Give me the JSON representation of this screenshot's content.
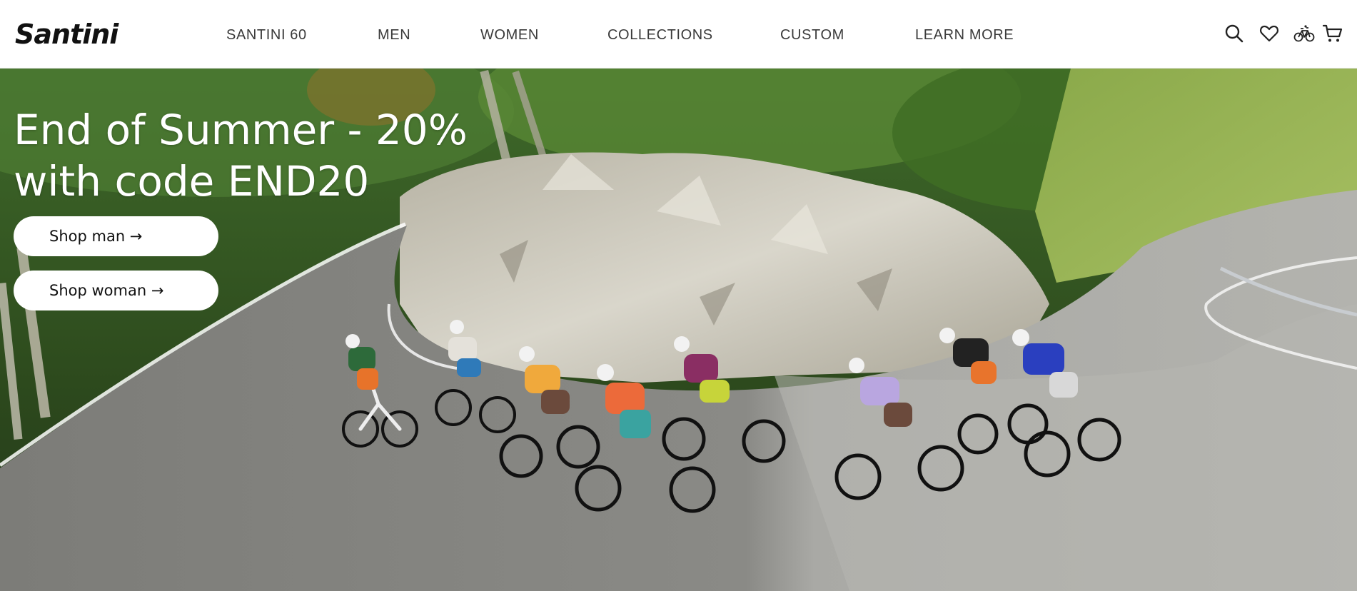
{
  "brand": {
    "name": "Santini"
  },
  "nav": {
    "items": [
      {
        "label": "SANTINI 60"
      },
      {
        "label": "MEN"
      },
      {
        "label": "WOMEN"
      },
      {
        "label": "COLLECTIONS"
      },
      {
        "label": "CUSTOM"
      },
      {
        "label": "LEARN MORE"
      }
    ]
  },
  "header_icons": [
    "search-icon",
    "heart-icon",
    "bicycle-icon",
    "cart-icon"
  ],
  "hero": {
    "title_line1": "End of Summer - 20%",
    "title_line2": "with code END20",
    "cta_man": "Shop man →",
    "cta_woman": "Shop woman →"
  },
  "colors": {
    "header_bg": "#ffffff",
    "nav_text": "#3a3a3a",
    "hero_text": "#ffffff",
    "button_bg": "#ffffff",
    "button_text": "#111111"
  }
}
